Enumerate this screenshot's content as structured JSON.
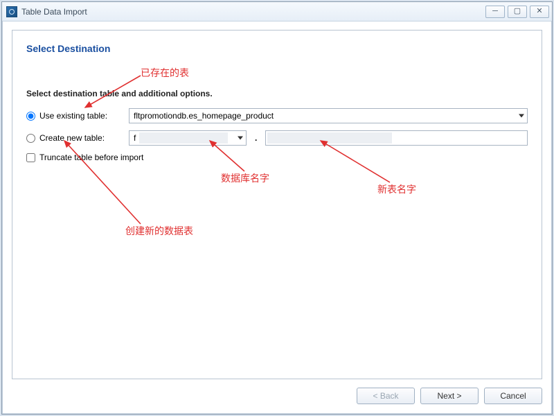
{
  "window": {
    "title": "Table Data Import"
  },
  "page": {
    "heading": "Select Destination",
    "subheading": "Select destination table and additional options."
  },
  "options": {
    "use_existing_label": "Use existing table:",
    "use_existing_value": "fltpromotiondb.es_homepage_product",
    "create_new_label": "Create new table:",
    "create_new_db_value": "f",
    "create_new_table_value": "",
    "truncate_label": "Truncate table before import"
  },
  "footer": {
    "back": "< Back",
    "next": "Next >",
    "cancel": "Cancel"
  },
  "annotations": {
    "existing_table": "已存在的表",
    "db_name": "数据库名字",
    "new_table_name": "新表名字",
    "create_new": "创建新的数据表"
  }
}
